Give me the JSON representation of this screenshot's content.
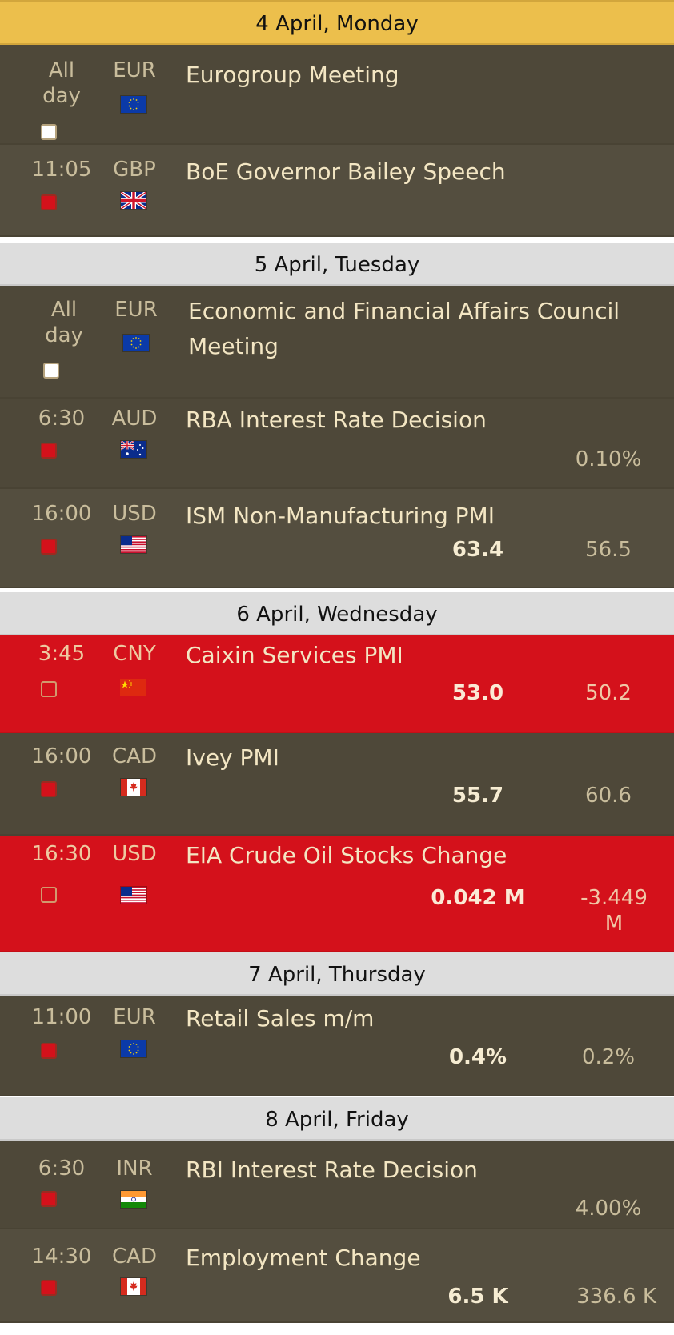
{
  "colors": {
    "header_active": "#ecbf4c",
    "header": "#dddddd",
    "row": "#4e4839",
    "row_alt": "#544e3f",
    "high_impact": "#d4111b",
    "text": "#f3e6c3",
    "muted": "#c9bd9c"
  },
  "days": [
    {
      "label": "4 April, Monday",
      "events": [
        {
          "time": "All\nday",
          "currency": "EUR",
          "flag": "eu-flag-icon",
          "title": "Eurogroup Meeting",
          "importance": "none",
          "actual": "",
          "previous": ""
        },
        {
          "time": "11:05",
          "currency": "GBP",
          "flag": "uk-flag-icon",
          "title": "BoE Governor Bailey Speech",
          "importance": "high",
          "actual": "",
          "previous": ""
        }
      ]
    },
    {
      "label": "5 April, Tuesday",
      "events": [
        {
          "time": "All\nday",
          "currency": "EUR",
          "flag": "eu-flag-icon",
          "title": "Economic and Financial Affairs Council Meeting",
          "importance": "none",
          "actual": "",
          "previous": ""
        },
        {
          "time": "6:30",
          "currency": "AUD",
          "flag": "australia-flag-icon",
          "title": "RBA Interest Rate Decision",
          "importance": "high",
          "actual": "",
          "previous": "0.10%"
        },
        {
          "time": "16:00",
          "currency": "USD",
          "flag": "us-flag-icon",
          "title": "ISM Non-Manufacturing PMI",
          "importance": "high",
          "actual": "63.4",
          "previous": "56.5"
        }
      ]
    },
    {
      "label": "6 April, Wednesday",
      "events": [
        {
          "time": "3:45",
          "currency": "CNY",
          "flag": "china-flag-icon",
          "title": "Caixin Services PMI",
          "importance": "high",
          "actual": "53.0",
          "previous": "50.2"
        },
        {
          "time": "16:00",
          "currency": "CAD",
          "flag": "canada-flag-icon",
          "title": "Ivey PMI",
          "importance": "high",
          "actual": "55.7",
          "previous": "60.6"
        },
        {
          "time": "16:30",
          "currency": "USD",
          "flag": "us-flag-icon",
          "title": "EIA Crude Oil Stocks Change",
          "importance": "high",
          "actual": "0.042 M",
          "previous": "-3.449 M"
        }
      ]
    },
    {
      "label": "7 April, Thursday",
      "events": [
        {
          "time": "11:00",
          "currency": "EUR",
          "flag": "eu-flag-icon",
          "title": "Retail Sales m/m",
          "importance": "high",
          "actual": "0.4%",
          "previous": "0.2%"
        }
      ]
    },
    {
      "label": "8 April, Friday",
      "events": [
        {
          "time": "6:30",
          "currency": "INR",
          "flag": "india-flag-icon",
          "title": "RBI Interest Rate Decision",
          "importance": "high",
          "actual": "",
          "previous": "4.00%"
        },
        {
          "time": "14:30",
          "currency": "CAD",
          "flag": "canada-flag-icon",
          "title": "Employment Change",
          "importance": "high",
          "actual": "6.5 K",
          "previous": "336.6 K"
        }
      ]
    }
  ]
}
